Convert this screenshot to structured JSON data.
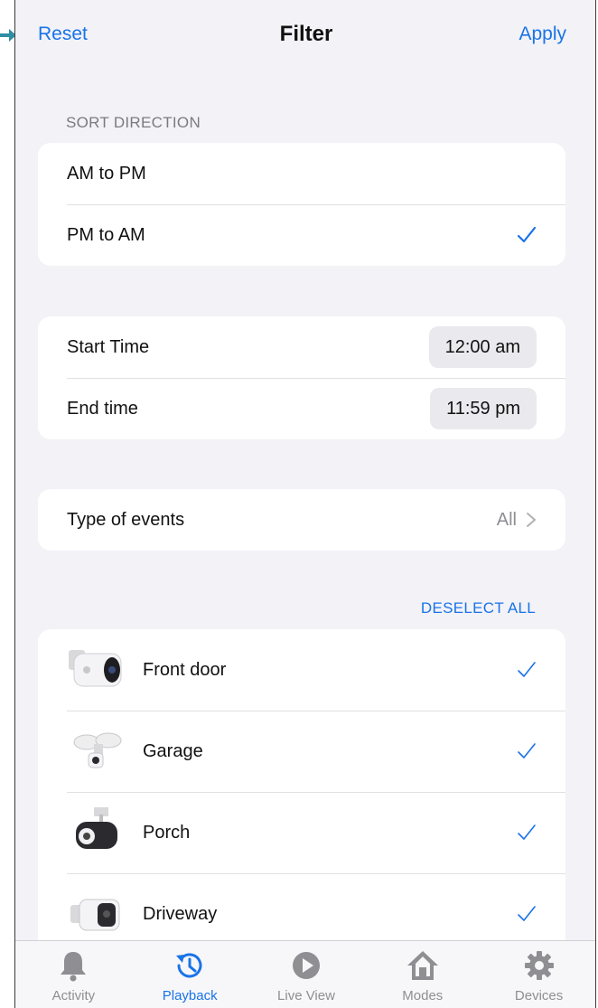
{
  "nav": {
    "reset_label": "Reset",
    "title": "Filter",
    "apply_label": "Apply"
  },
  "sort": {
    "section_label": "SORT DIRECTION",
    "options": [
      {
        "label": "AM to PM",
        "selected": false
      },
      {
        "label": "PM to AM",
        "selected": true
      }
    ]
  },
  "time": {
    "start_label": "Start Time",
    "start_value": "12:00 am",
    "end_label": "End time",
    "end_value": "11:59 pm"
  },
  "events": {
    "label": "Type of events",
    "value": "All"
  },
  "cameras": {
    "deselect_label": "DESELECT ALL",
    "items": [
      {
        "label": "Front door",
        "selected": true,
        "icon": "bullet-camera-icon"
      },
      {
        "label": "Garage",
        "selected": true,
        "icon": "floodlight-camera-icon"
      },
      {
        "label": "Porch",
        "selected": true,
        "icon": "spotlight-camera-icon"
      },
      {
        "label": "Driveway",
        "selected": true,
        "icon": "wire-free-camera-icon"
      }
    ]
  },
  "tabbar": {
    "tabs": [
      {
        "label": "Activity",
        "icon": "bell-icon",
        "active": false
      },
      {
        "label": "Playback",
        "icon": "history-icon",
        "active": true
      },
      {
        "label": "Live View",
        "icon": "play-icon",
        "active": false
      },
      {
        "label": "Modes",
        "icon": "house-icon",
        "active": false
      },
      {
        "label": "Devices",
        "icon": "gear-icon",
        "active": false
      }
    ]
  },
  "colors": {
    "accent": "#1a73e8",
    "background": "#f2f2f7",
    "inactive": "#8e8e93"
  }
}
